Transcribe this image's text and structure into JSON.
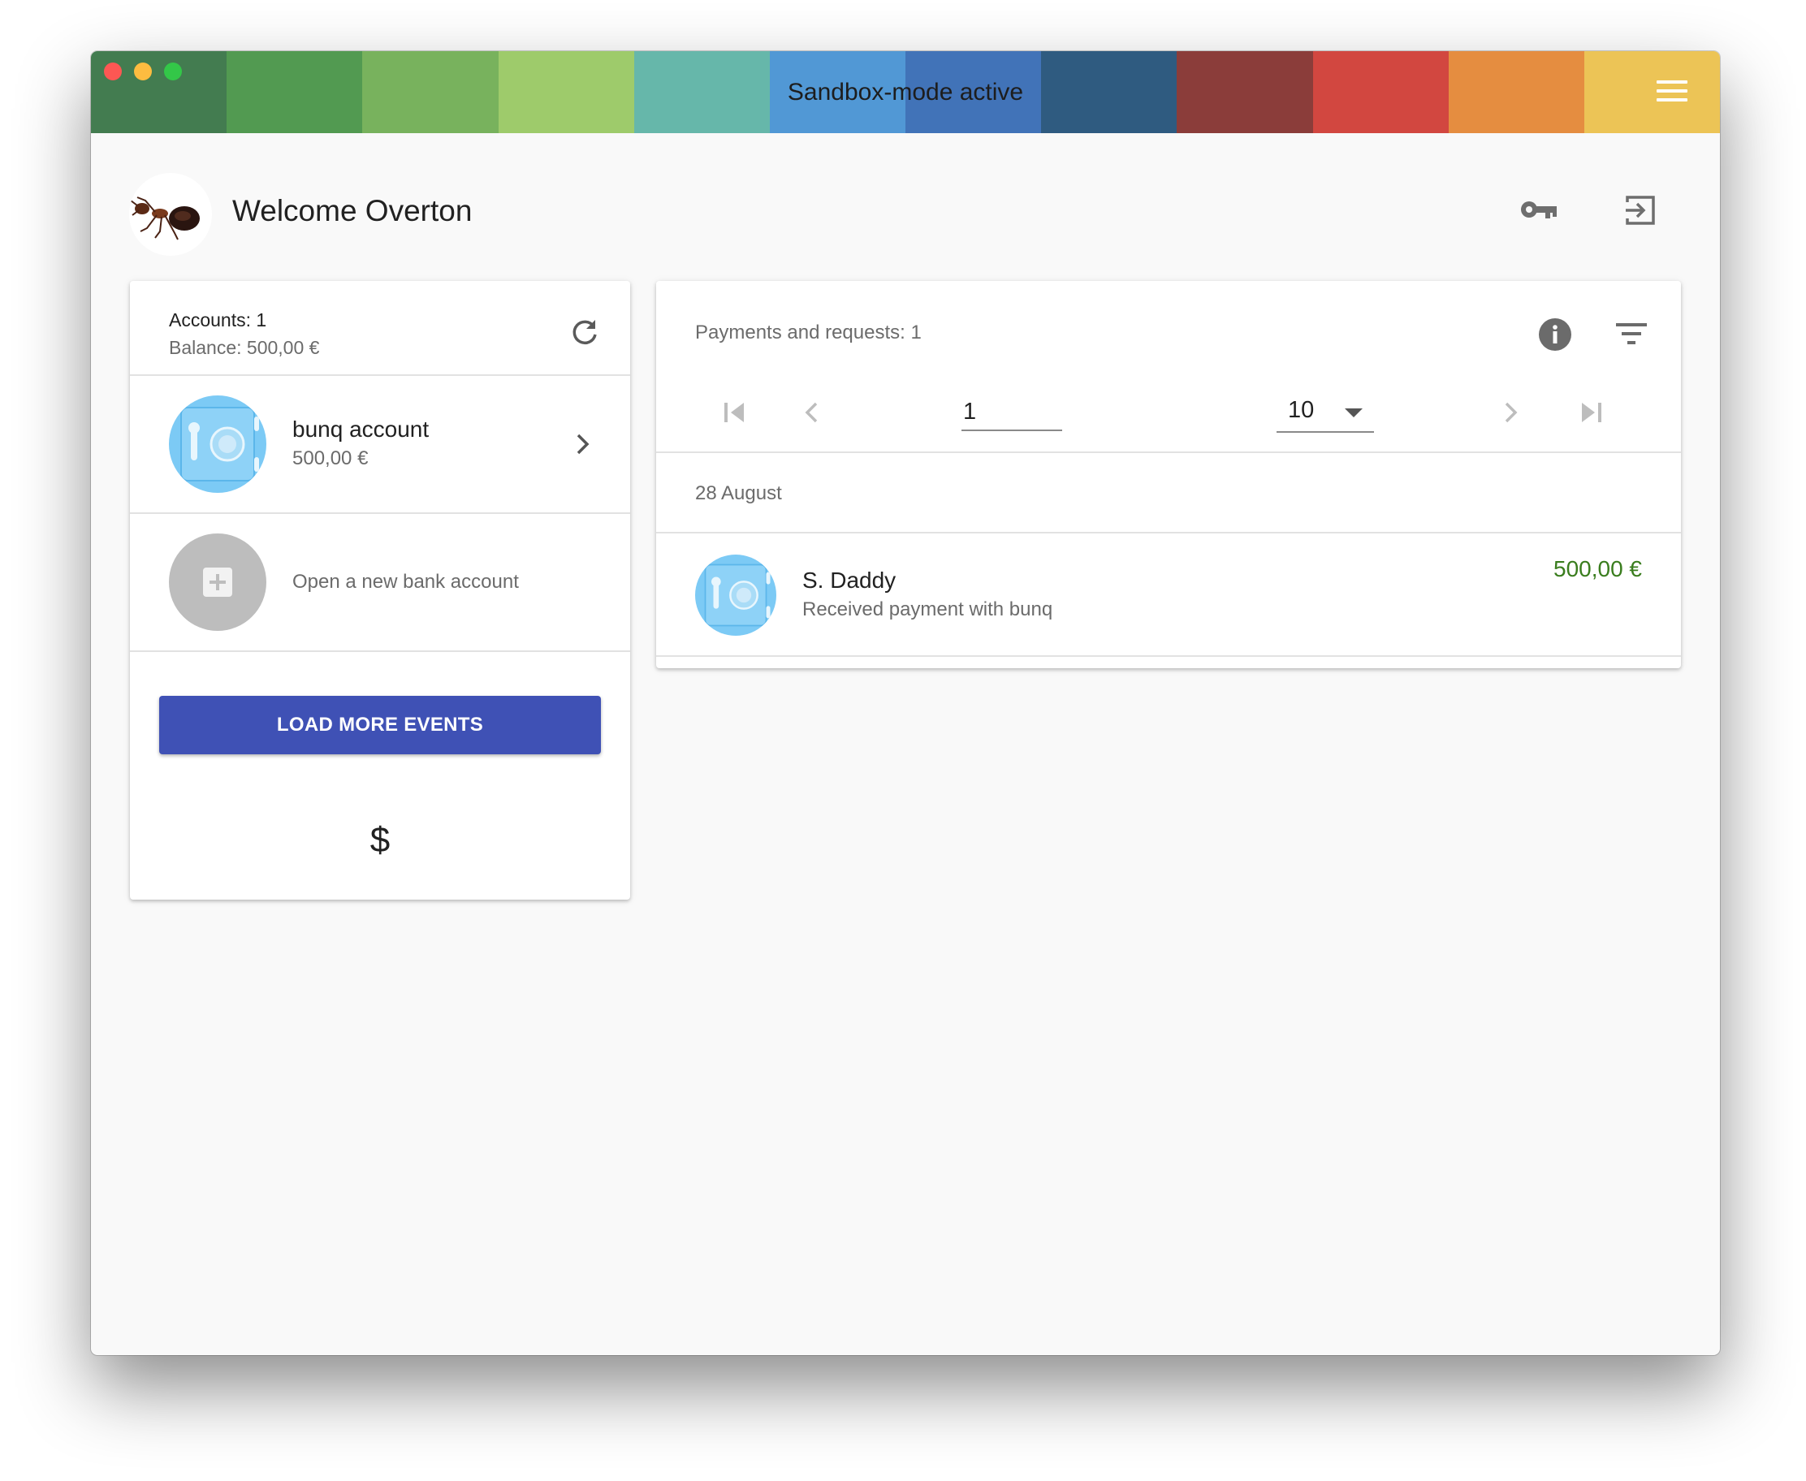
{
  "window": {
    "title": "Sandbox-mode active",
    "stripe_colors": [
      "#437c50",
      "#529a51",
      "#78b25d",
      "#9ecb6b",
      "#66b7aa",
      "#5198d5",
      "#4173b8",
      "#2f5b80",
      "#8b3d3a",
      "#d24740",
      "#e58d40",
      "#ecc456"
    ],
    "traffic_colors": {
      "close": "#fc5753",
      "minimize": "#fdbc40",
      "zoom": "#33c748"
    }
  },
  "header": {
    "welcome": "Welcome Overton",
    "avatar_icon": "ant-avatar",
    "key_icon": "key-icon",
    "logout_icon": "logout-icon"
  },
  "accounts_panel": {
    "accounts_count": "Accounts: 1",
    "balance": "Balance: 500,00 €",
    "refresh_icon": "refresh-icon",
    "account": {
      "name": "bunq account",
      "balance": "500,00 €",
      "icon": "safe-icon"
    },
    "new_account_label": "Open a new bank account",
    "load_more": "LOAD MORE EVENTS",
    "footer_symbol": "$"
  },
  "payments_panel": {
    "title": "Payments and requests: 1",
    "info_icon": "info-icon",
    "filter_icon": "filter-icon",
    "page_number": "1",
    "page_size": "10",
    "date_header": "28 August",
    "payment": {
      "name": "S. Daddy",
      "description": "Received payment with bunq",
      "amount": "500,00 €",
      "amount_color": "#3a7d1e",
      "icon": "safe-icon"
    }
  },
  "colors": {
    "primary": "#3f51b5",
    "safe_blue": "#7ccaf5",
    "muted_icon": "#6e6e6e"
  }
}
